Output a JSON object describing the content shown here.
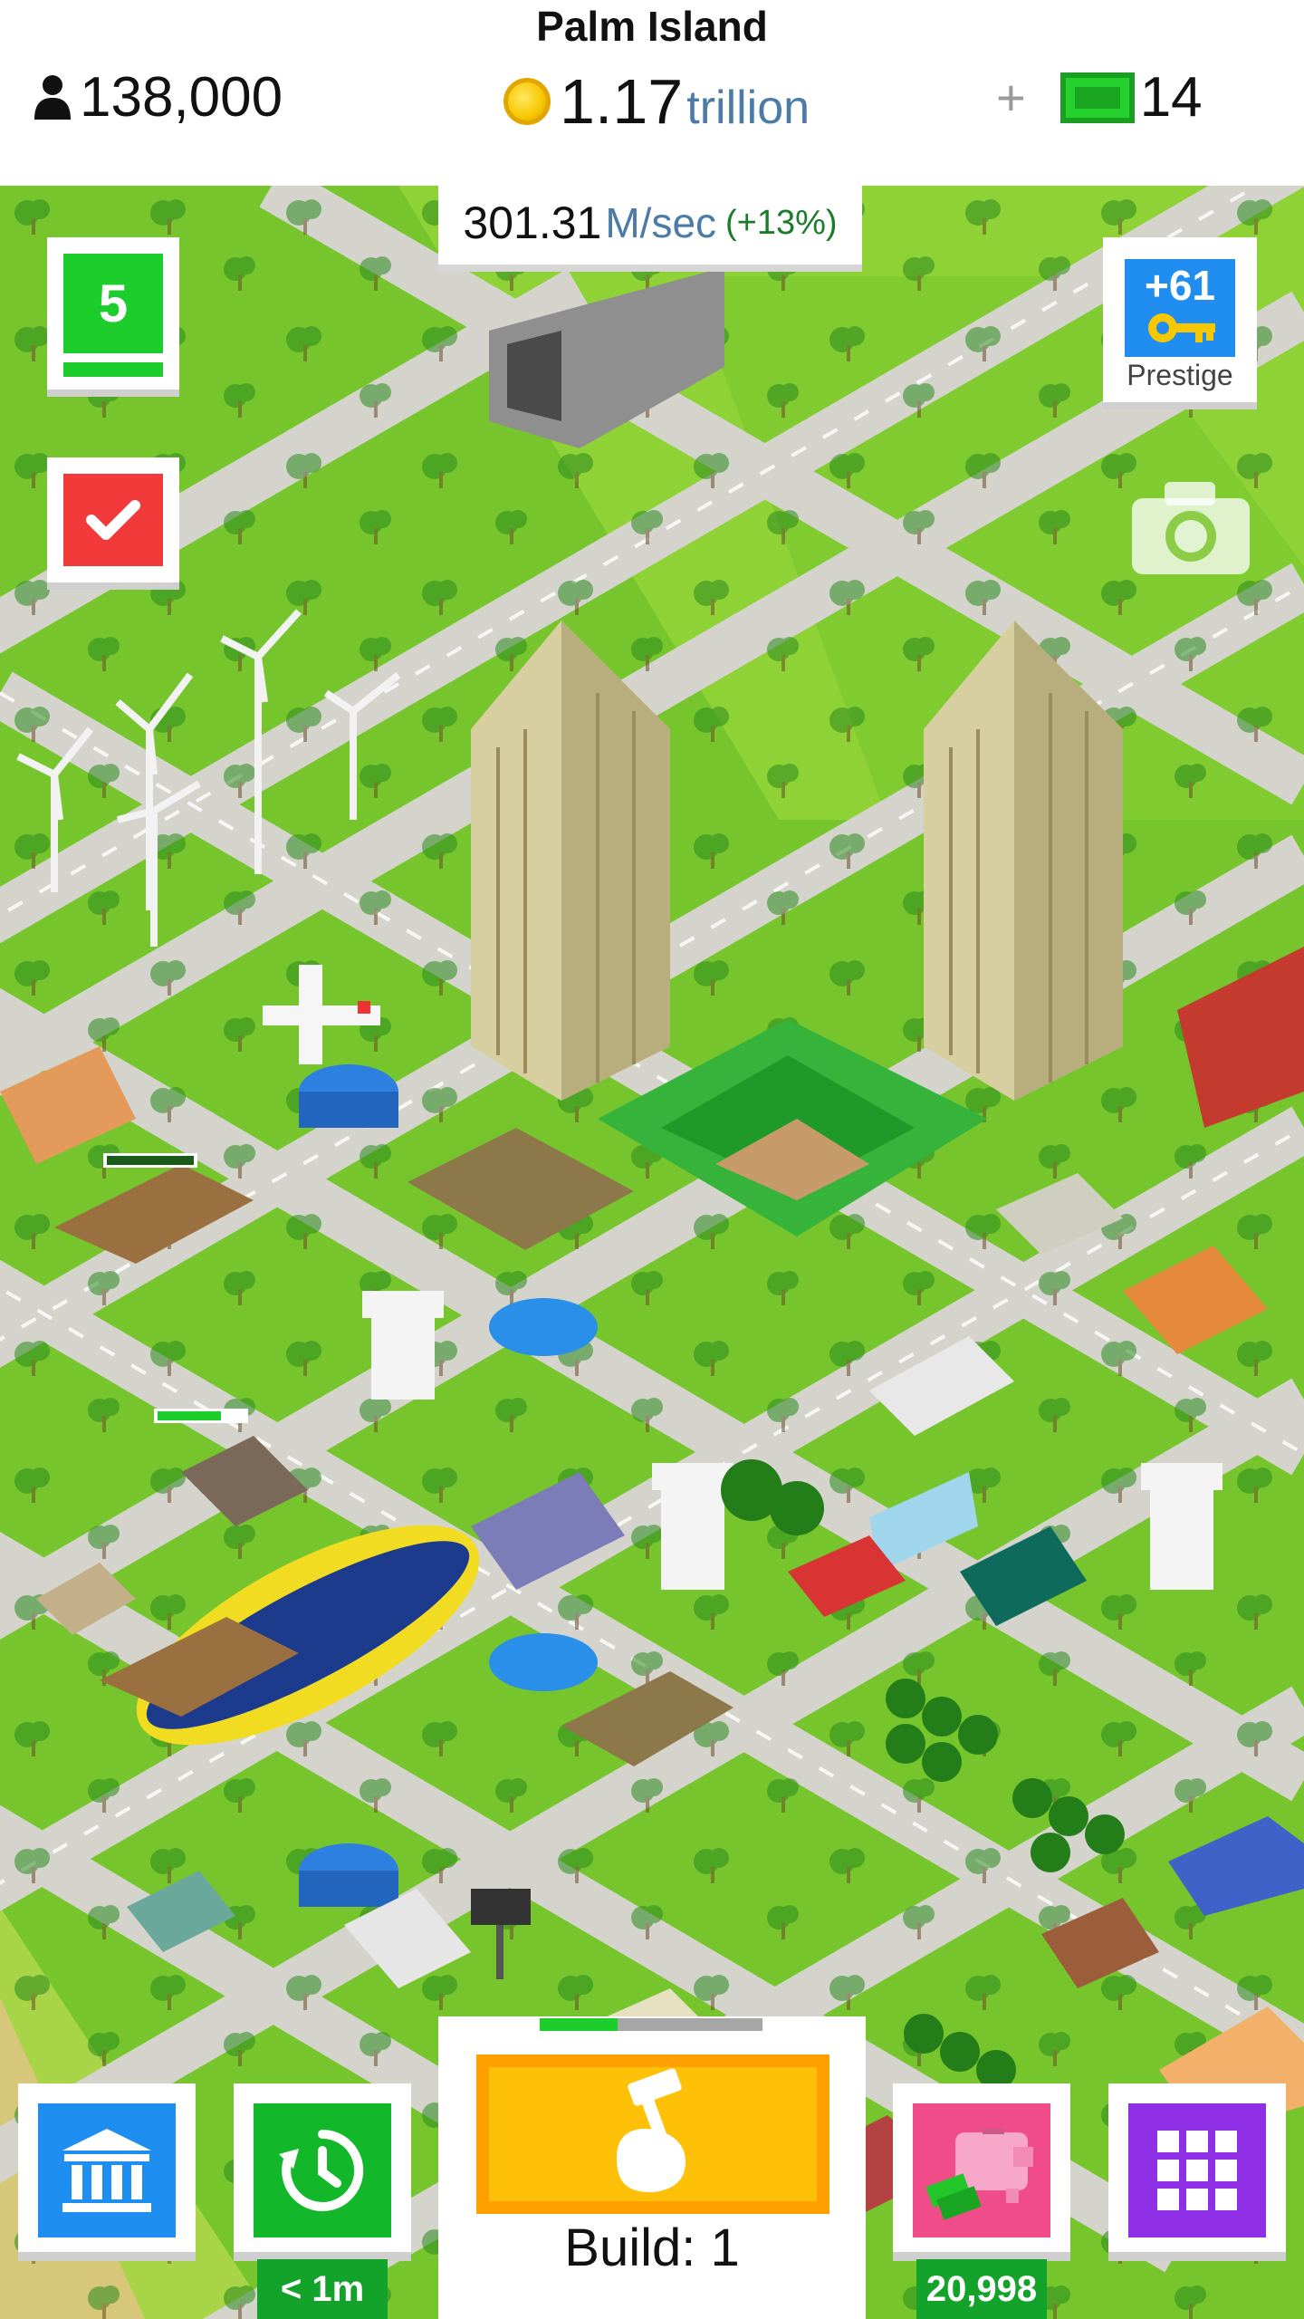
{
  "header": {
    "city_name": "Palm Island",
    "population": "138,000",
    "coins_value": "1.17",
    "coins_unit": "trillion",
    "cash_plus": "+",
    "cash_value": "14"
  },
  "income": {
    "value": "301.31",
    "unit": "M/sec",
    "bonus": "(+13%)"
  },
  "level_badge": {
    "value": "5"
  },
  "prestige": {
    "value": "+61",
    "label": "Prestige"
  },
  "build": {
    "label": "Build: 1",
    "progress": 0.35
  },
  "timer": {
    "caption": "< 1m"
  },
  "piggy_bank": {
    "caption": "20,998"
  },
  "icons": {
    "population": "person-icon",
    "coins": "coin-icon",
    "cash": "cash-bill-icon",
    "tasks": "checkmark-icon",
    "prestige": "key-icon",
    "screenshot": "camera-icon",
    "bank": "bank-icon",
    "timer": "clock-rewind-icon",
    "build": "hammer-hand-icon",
    "piggy": "piggy-bank-icon",
    "menu": "grid-menu-icon"
  },
  "colors": {
    "grass": "#77c52d",
    "coin_unit": "#4b7ba6",
    "bank_button": "#1e8ef0",
    "timer_button": "#13b82a",
    "build_button": "#ffc107",
    "piggy_button": "#f04c8a",
    "menu_button": "#8e2fe6",
    "tasks_button": "#f23a3a",
    "level_badge": "#1ccd2c"
  }
}
